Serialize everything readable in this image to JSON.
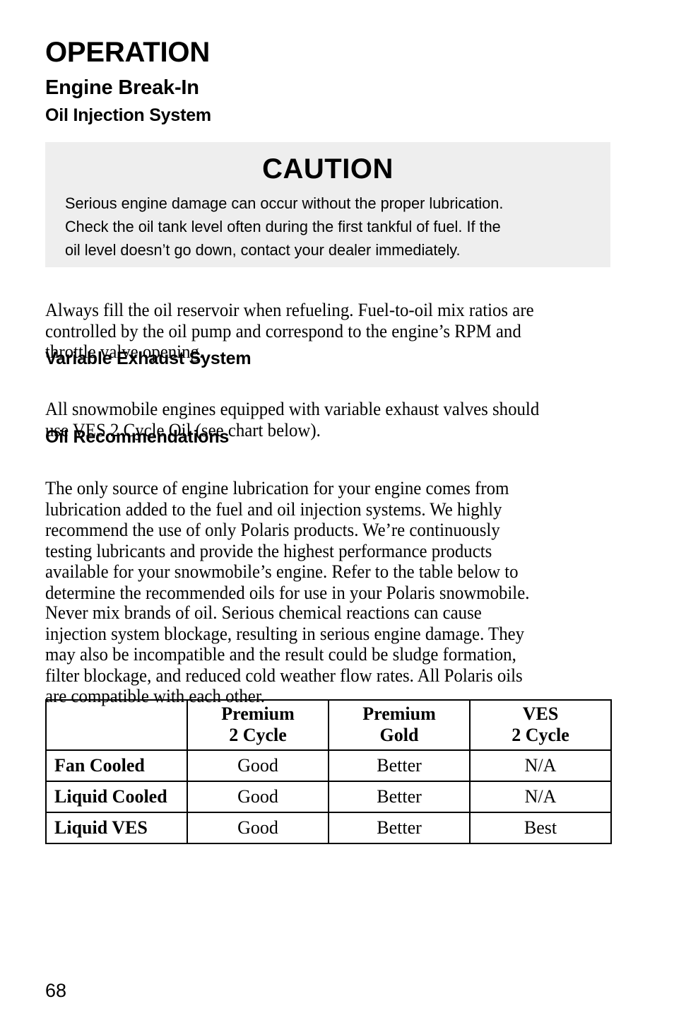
{
  "document": {
    "chapter_title": "OPERATION",
    "section_heading": "Engine Break-In",
    "subsection_heading": "Oil Injection System",
    "page_number": "68"
  },
  "caution": {
    "title": "CAUTION",
    "body": "Serious engine damage can occur without the proper lubrication.\nCheck the oil tank level often during the first tankful of fuel.  If the\noil level doesn’t go down, contact your dealer immediately.",
    "background_color": "#eeeeee"
  },
  "paragraphs": {
    "refueling": "Always fill the oil reservoir when refueling. Fuel-to-oil mix ratios are\ncontrolled by the oil pump and correspond to the engine’s RPM and\nthrottle valve opening.",
    "variable_exhaust": "All snowmobile engines equipped with variable exhaust valves should\nuse VES 2 Cycle Oil (see chart below).",
    "oil_recommendations": "The only source of engine lubrication for your engine comes from\nlubrication added to the fuel and oil injection systems.  We highly\nrecommend the use of only Polaris products.  We’re continuously\ntesting lubricants and provide the highest performance products\navailable for your snowmobile’s engine.  Refer to the table below to\ndetermine the recommended oils for use in your Polaris snowmobile.",
    "never_mix": "Never mix brands of oil.  Serious chemical reactions can cause\ninjection system blockage, resulting in serious engine damage.  They\nmay also be incompatible and the result could be sludge formation,\nfilter blockage, and reduced cold weather flow rates.  All Polaris oils\nare compatible with each other."
  },
  "headings": {
    "variable_exhaust": "Variable Exhaust System",
    "oil_recommendations": "Oil Recommendations"
  },
  "oil_table": {
    "columns": [
      "",
      "Premium\n2 Cycle",
      "Premium\nGold",
      "VES\n2 Cycle"
    ],
    "rows": [
      {
        "label": "Fan Cooled",
        "values": [
          "Good",
          "Better",
          "N/A"
        ]
      },
      {
        "label": "Liquid Cooled",
        "values": [
          "Good",
          "Better",
          "N/A"
        ]
      },
      {
        "label": "Liquid VES",
        "values": [
          "Good",
          "Better",
          "Best"
        ]
      }
    ]
  }
}
